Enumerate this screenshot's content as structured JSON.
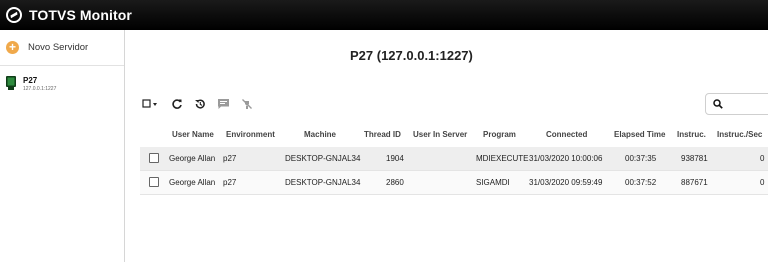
{
  "app": {
    "title": "TOTVS Monitor"
  },
  "sidebar": {
    "new_server_label": "Novo Servidor",
    "servers": [
      {
        "name": "P27",
        "address": "127.0.0.1:1227"
      }
    ]
  },
  "main": {
    "title": "P27 (127.0.0.1:1227)",
    "toolbar": {
      "icons": [
        "checkbox-select-icon",
        "refresh-icon",
        "history-icon",
        "message-icon",
        "disconnect-icon"
      ]
    },
    "search": {
      "placeholder": "",
      "icon": "search-icon"
    },
    "table": {
      "columns": [
        "User Name",
        "Environment",
        "Machine",
        "Thread ID",
        "User In Server",
        "Program",
        "Connected",
        "Elapsed Time",
        "Instruc.",
        "Instruc./Sec"
      ],
      "rows": [
        [
          "George Allan",
          "p27",
          "DESKTOP-GNJAL34",
          "1904",
          "",
          "MDIEXECUTE",
          "31/03/2020 10:00:06",
          "00:37:35",
          "938781",
          "0"
        ],
        [
          "George Allan",
          "p27",
          "DESKTOP-GNJAL34",
          "2860",
          "",
          "SIGAMDI",
          "31/03/2020 09:59:49",
          "00:37:52",
          "887671",
          "0"
        ]
      ]
    }
  },
  "colors": {
    "titlebar": "#000000",
    "accent": "#f0a94b",
    "server_icon": "#1f6f2e"
  }
}
